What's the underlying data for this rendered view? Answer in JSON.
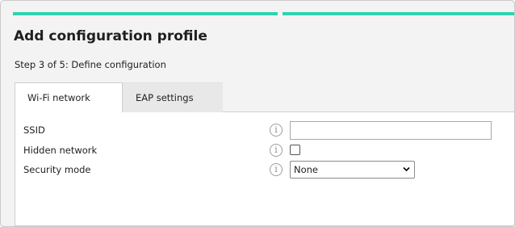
{
  "colors": {
    "accent": "#2ed3b0"
  },
  "wizard": {
    "title": "Add configuration profile",
    "step": "Step 3 of 5: Define configuration"
  },
  "tabs": [
    {
      "label": "Wi-Fi network",
      "active": true
    },
    {
      "label": "EAP settings",
      "active": false
    }
  ],
  "form": {
    "ssid": {
      "label": "SSID",
      "value": "",
      "icon": "info-icon"
    },
    "hidden": {
      "label": "Hidden network",
      "checked": false,
      "icon": "info-icon"
    },
    "security": {
      "label": "Security mode",
      "selected": "None",
      "icon": "info-icon"
    }
  }
}
